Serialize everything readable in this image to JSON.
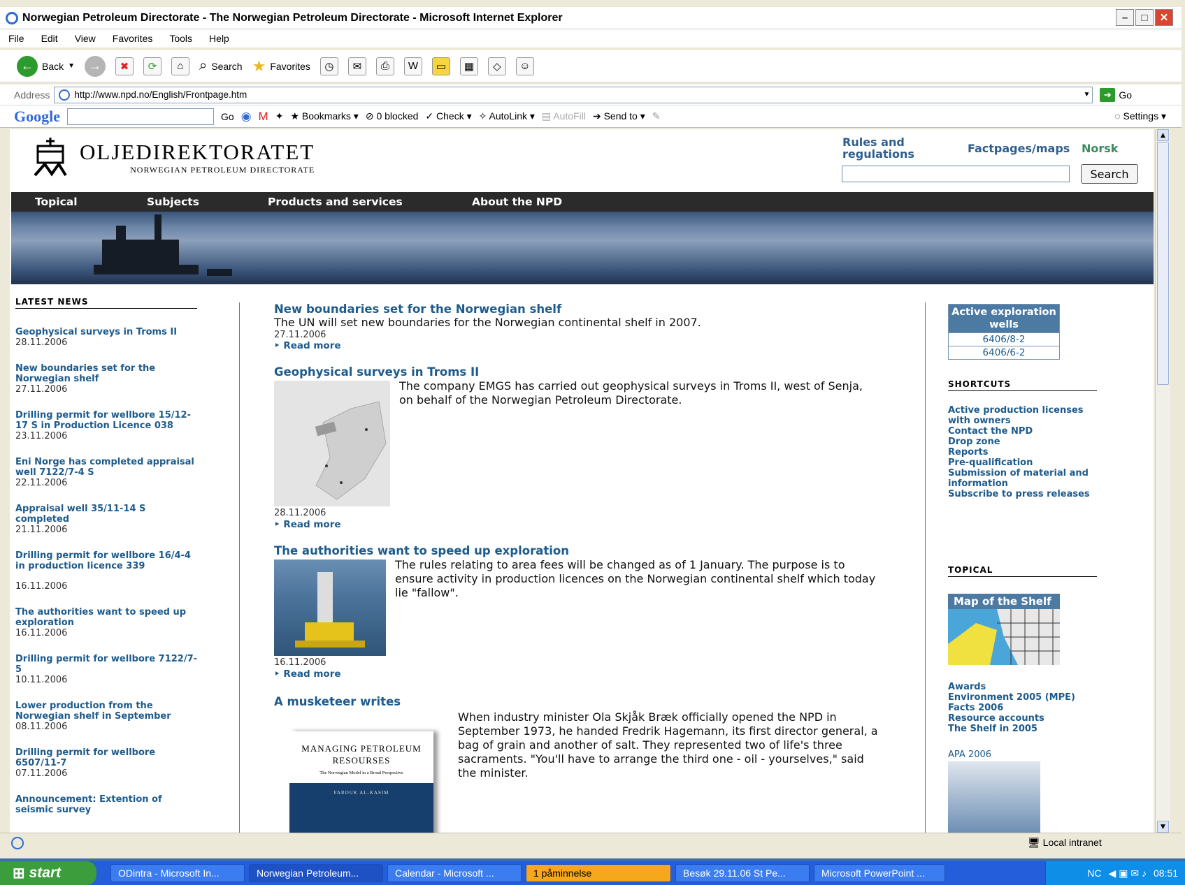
{
  "window": {
    "title": "Norwegian Petroleum Directorate - The Norwegian Petroleum Directorate - Microsoft Internet Explorer"
  },
  "menu": [
    "File",
    "Edit",
    "View",
    "Favorites",
    "Tools",
    "Help"
  ],
  "toolbar": {
    "back": "Back",
    "search": "Search",
    "favorites": "Favorites"
  },
  "address": {
    "label": "Address",
    "url": "http://www.npd.no/English/Frontpage.htm",
    "go": "Go"
  },
  "googlebar": {
    "logo": "Google",
    "go": "Go",
    "bookmarks": "Bookmarks",
    "blocked": "0 blocked",
    "check": "Check",
    "autolink": "AutoLink",
    "autofill": "AutoFill",
    "sendto": "Send to",
    "settings": "Settings"
  },
  "site": {
    "logo_main": "OLJEDIREKTORATET",
    "logo_sub": "NORWEGIAN PETROLEUM DIRECTORATE",
    "link_rules": "Rules and regulations",
    "link_factpages": "Factpages/maps",
    "link_norsk": "Norsk",
    "search_button": "Search",
    "nav": [
      "Topical",
      "Subjects",
      "Products and services",
      "About the NPD"
    ]
  },
  "latest_news": {
    "heading": "LATEST NEWS",
    "items": [
      {
        "title": "Geophysical surveys in Troms II",
        "date": "28.11.2006"
      },
      {
        "title": "New boundaries set for the Norwegian shelf",
        "date": "27.11.2006"
      },
      {
        "title": "Drilling permit for wellbore 15/12-17 S in Production Licence 038",
        "date": "23.11.2006"
      },
      {
        "title": "Eni Norge has completed appraisal well 7122/7-4 S",
        "date": "22.11.2006"
      },
      {
        "title": "Appraisal well 35/11-14 S completed",
        "date": "21.11.2006"
      },
      {
        "title": "Drilling permit for wellbore 16/4-4 in production licence 339",
        "date": "16.11.2006"
      },
      {
        "title": "The authorities want to speed up exploration",
        "date": "16.11.2006"
      },
      {
        "title": "Drilling permit for wellbore 7122/7-5",
        "date": "10.11.2006"
      },
      {
        "title": "Lower production from the Norwegian shelf in September",
        "date": "08.11.2006"
      },
      {
        "title": "Drilling permit for wellbore 6507/11-7",
        "date": "07.11.2006"
      },
      {
        "title": "Announcement: Extention of seismic survey",
        "date": ""
      }
    ]
  },
  "articles": [
    {
      "title": "New boundaries set for the Norwegian shelf",
      "body": "The UN will set new boundaries for the Norwegian continental shelf in 2007.",
      "date": "27.11.2006",
      "more": "Read more"
    },
    {
      "title": "Geophysical surveys in Troms II",
      "body": "The company EMGS has carried out geophysical surveys in Troms II, west of Senja, on behalf of the Norwegian Petroleum Directorate.",
      "date": "28.11.2006",
      "more": "Read more"
    },
    {
      "title": "The authorities want to speed up exploration",
      "body": "The rules relating to area fees will be changed as of 1 January. The purpose is to ensure activity in production licences on the Norwegian continental shelf which today lie \"fallow\".",
      "date": "16.11.2006",
      "more": "Read more"
    },
    {
      "title": "A musketeer writes",
      "body": "When industry minister Ola Skjåk Bræk officially opened the NPD in September 1973, he handed Fredrik Hagemann, its first director general, a bag of grain and another of salt. They represented two of life's three sacraments. \"You'll have to arrange the third one - oil - yourselves,\" said the minister."
    }
  ],
  "book": {
    "title_l1": "MANAGING PETROLEUM",
    "title_l2": "RESOURSES",
    "subtitle": "The Norwegian Model in a Broad Perspective",
    "author": "FAROUK AL-KASIM"
  },
  "right": {
    "active_wells_title": "Active exploration wells",
    "wells": [
      "6406/8-2",
      "6406/6-2"
    ],
    "shortcuts_heading": "SHORTCUTS",
    "shortcuts": [
      "Active production licenses with owners",
      "Contact the NPD",
      "Drop zone",
      "Reports",
      "Pre-qualification",
      "Submission of material and information",
      "Subscribe to press releases"
    ],
    "topical_heading": "TOPICAL",
    "map_title": "Map of the Shelf",
    "topical_links": [
      "Awards",
      "Environment 2005 (MPE)",
      "Facts 2006",
      "Resource accounts",
      "The Shelf in 2005"
    ],
    "apa": "APA 2006"
  },
  "status": {
    "zone": "Local intranet"
  },
  "taskbar": {
    "start": "start",
    "tasks": [
      "ODintra - Microsoft In...",
      "Norwegian Petroleum...",
      "Calendar - Microsoft ...",
      "1 påminnelse",
      "Besøk 29.11.06 St Pe...",
      "Microsoft PowerPoint ..."
    ],
    "lang": "NC",
    "clock": "08:51"
  }
}
